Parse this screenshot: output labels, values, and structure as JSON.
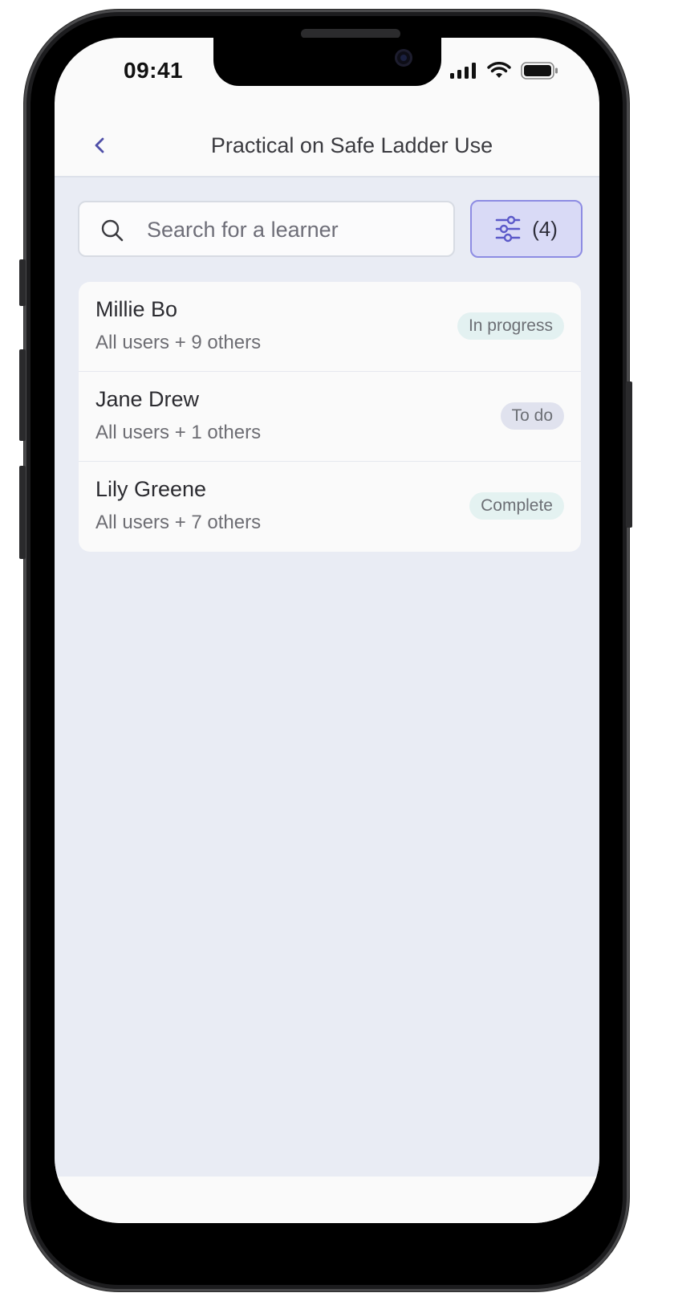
{
  "status_bar": {
    "time": "09:41"
  },
  "header": {
    "title": "Practical on Safe Ladder Use"
  },
  "search": {
    "placeholder": "Search for a learner",
    "value": ""
  },
  "filter": {
    "count_label": "(4)"
  },
  "learners": [
    {
      "name": "Millie Bo",
      "groups": "All users + 9 others",
      "status": "In progress",
      "status_color": "#e3f1f1"
    },
    {
      "name": "Jane Drew",
      "groups": "All users + 1 others",
      "status": "To do",
      "status_color": "#e0e2ee"
    },
    {
      "name": "Lily Greene",
      "groups": "All users + 7 others",
      "status": "Complete",
      "status_color": "#e4f2f1"
    }
  ],
  "theme": {
    "accent": "#8d8ce3",
    "accent_bg": "#d9daf6",
    "back_arrow": "#4f4fa8"
  }
}
